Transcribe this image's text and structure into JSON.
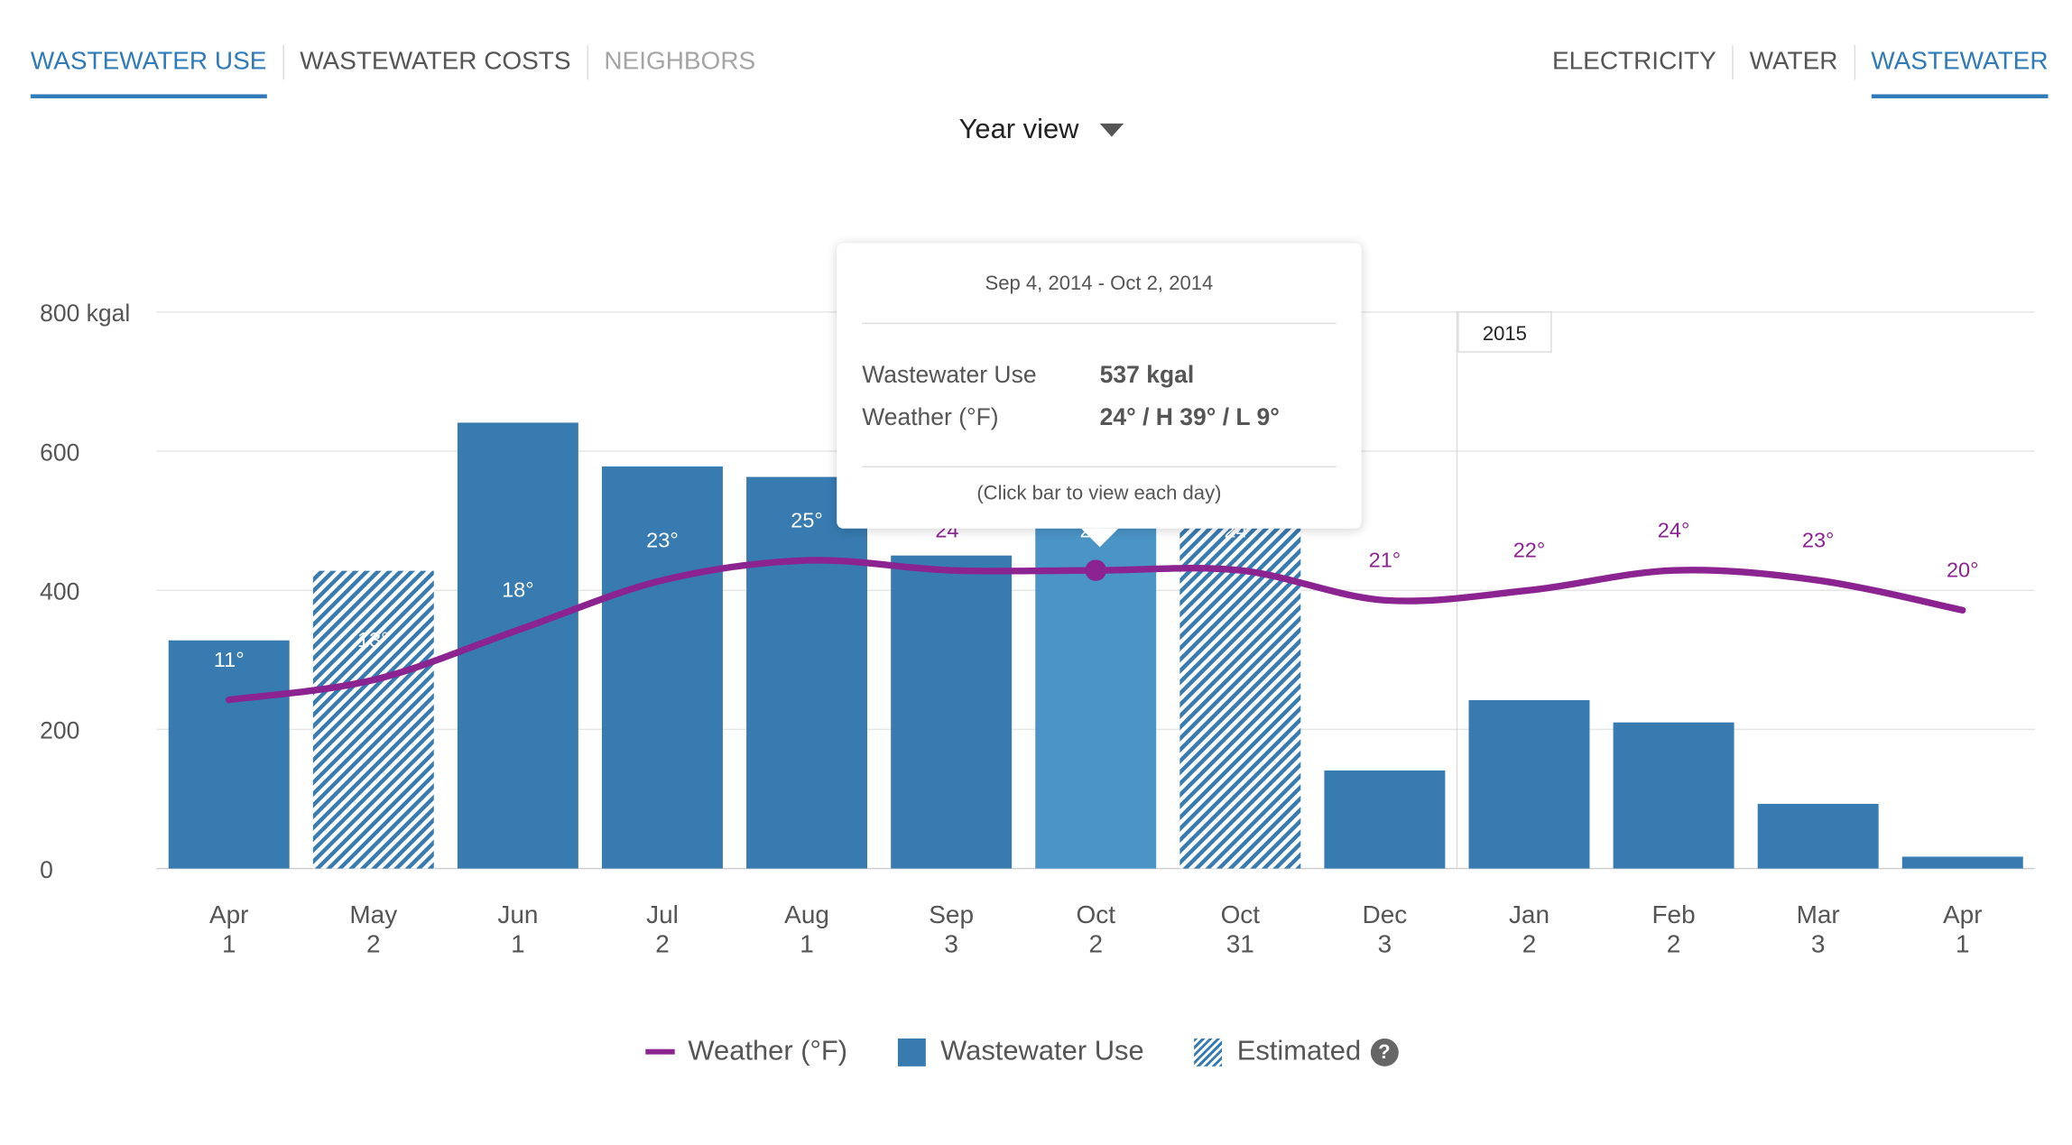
{
  "tabs_left": [
    {
      "label": "WASTEWATER USE",
      "state": "active"
    },
    {
      "label": "WASTEWATER COSTS",
      "state": "normal"
    },
    {
      "label": "NEIGHBORS",
      "state": "disabled"
    }
  ],
  "tabs_right": [
    {
      "label": "ELECTRICITY",
      "state": "normal"
    },
    {
      "label": "WATER",
      "state": "normal"
    },
    {
      "label": "WASTEWATER",
      "state": "active"
    }
  ],
  "view_selector": {
    "label": "Year view",
    "icon": "caret-down-icon"
  },
  "tooltip": {
    "date_range": "Sep 4, 2014 - Oct 2, 2014",
    "rows": [
      {
        "label": "Wastewater Use",
        "value": "537 kgal"
      },
      {
        "label": "Weather (°F)",
        "value": "24° / H 39° / L 9°"
      }
    ],
    "footer": "(Click bar to view each day)"
  },
  "legend": {
    "weather": "Weather (°F)",
    "use": "Wastewater Use",
    "estimated": "Estimated",
    "help": "?"
  },
  "colors": {
    "accent": "#2f7ab8",
    "bar": "#377bb0",
    "bar_selected": "#4a94c6",
    "weather": "#8b2391"
  },
  "chart_data": {
    "type": "bar",
    "categories": [
      [
        "Apr",
        "1"
      ],
      [
        "May",
        "2"
      ],
      [
        "Jun",
        "1"
      ],
      [
        "Jul",
        "2"
      ],
      [
        "Aug",
        "1"
      ],
      [
        "Sep",
        "3"
      ],
      [
        "Oct",
        "2"
      ],
      [
        "Oct",
        "31"
      ],
      [
        "Dec",
        "3"
      ],
      [
        "Jan",
        "2"
      ],
      [
        "Feb",
        "2"
      ],
      [
        "Mar",
        "3"
      ],
      [
        "Apr",
        "1"
      ]
    ],
    "ylim": [
      0,
      800
    ],
    "yticks": [
      "0",
      "200",
      "400",
      "600",
      "800 kgal"
    ],
    "ytick_values": [
      0,
      200,
      400,
      600,
      800
    ],
    "grid": true,
    "year_marker": {
      "label": "2015",
      "before_index": 9
    },
    "series": [
      {
        "name": "Wastewater Use",
        "type": "bar",
        "values": [
          328,
          428,
          641,
          578,
          563,
          450,
          537,
          520,
          141,
          242,
          210,
          93,
          17
        ],
        "estimated": [
          false,
          true,
          false,
          false,
          false,
          false,
          false,
          true,
          false,
          false,
          false,
          false,
          false
        ],
        "selected_index": 6
      },
      {
        "name": "Weather (°F)",
        "type": "line",
        "values": [
          11,
          13,
          18,
          23,
          25,
          24,
          24,
          24,
          21,
          22,
          24,
          23,
          20
        ],
        "labels": [
          "11°",
          "13°",
          "18°",
          "23°",
          "25°",
          "24°",
          "24°",
          "24°",
          "21°",
          "22°",
          "24°",
          "23°",
          "20°"
        ]
      }
    ],
    "legend": "bottom"
  }
}
